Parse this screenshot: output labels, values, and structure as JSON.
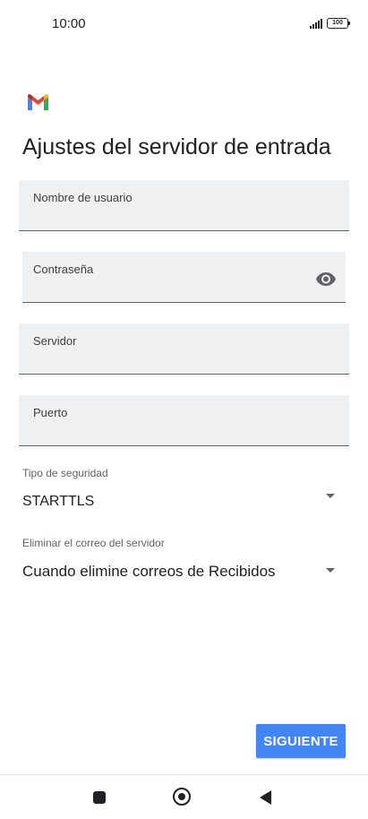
{
  "status_bar": {
    "time": "10:00",
    "battery": "100"
  },
  "page": {
    "title": "Ajustes del servidor de entrada"
  },
  "fields": {
    "username": {
      "label": "Nombre de usuario",
      "value": ""
    },
    "password": {
      "label": "Contraseña",
      "value": ""
    },
    "server": {
      "label": "Servidor",
      "value": ""
    },
    "port": {
      "label": "Puerto",
      "value": ""
    }
  },
  "security": {
    "label": "Tipo de seguridad",
    "value": "STARTTLS"
  },
  "delete_mail": {
    "label": "Eliminar el correo del servidor",
    "value": "Cuando elimine correos de Recibidos"
  },
  "actions": {
    "next_label": "SIGUIENTE"
  },
  "colors": {
    "accent": "#4285f4",
    "field_bg": "#eff0f1",
    "gmail_red": "#ea4335"
  }
}
